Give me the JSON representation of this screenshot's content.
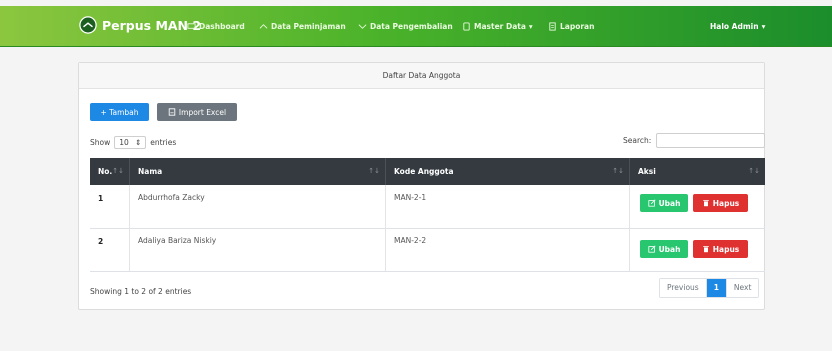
{
  "navbar": {
    "brand": "Perpus MAN 2",
    "items": [
      {
        "label": "Dashboard",
        "icon": "monitor-icon"
      },
      {
        "label": "Data Peminjaman",
        "icon": "chevron-up-icon"
      },
      {
        "label": "Data Pengembalian",
        "icon": "chevron-down-icon"
      },
      {
        "label": "Master Data",
        "icon": "folder-icon"
      },
      {
        "label": "Laporan",
        "icon": "document-icon"
      }
    ],
    "admin": "Halo Admin"
  },
  "card": {
    "title": "Daftar Data Anggota",
    "add_label": "+ Tambah",
    "import_label": "Import Excel"
  },
  "table_controls": {
    "show_label": "Show",
    "entries_value": "10",
    "entries_label": "entries",
    "search_label": "Search:",
    "search_value": ""
  },
  "table": {
    "columns": [
      "No.",
      "Nama",
      "Kode Anggota",
      "Aksi"
    ],
    "rows": [
      {
        "no": "1",
        "nama": "Abdurrhofa Zacky",
        "kode": "MAN-2-1"
      },
      {
        "no": "2",
        "nama": "Adaliya Bariza Niskiy",
        "kode": "MAN-2-2"
      }
    ],
    "edit_label": "Ubah",
    "delete_label": "Hapus"
  },
  "footer": {
    "info": "Showing 1 to 2 of 2 entries",
    "prev": "Previous",
    "page": "1",
    "next": "Next"
  },
  "colors": {
    "primary": "#1e88e5",
    "success": "#28c76f",
    "danger": "#e03131",
    "dark": "#343a40"
  }
}
